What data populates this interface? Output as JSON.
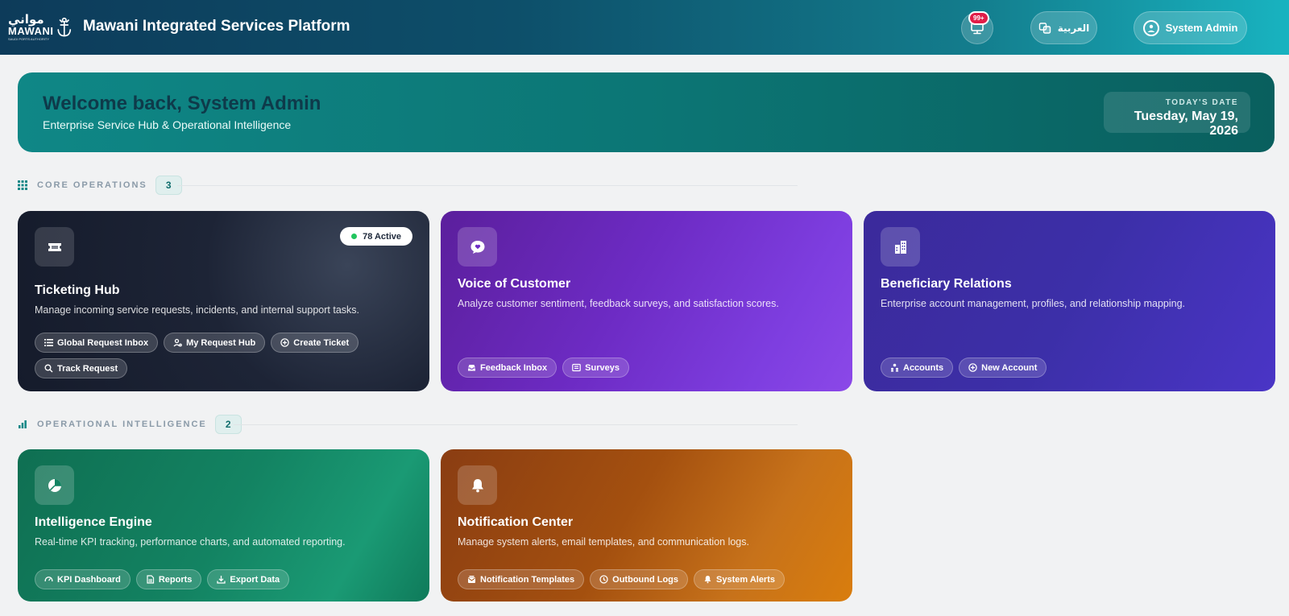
{
  "header": {
    "logo_ar": "مواني",
    "logo_en": "MAWANI",
    "logo_sub": "SAUDI PORTS AUTHORITY",
    "app_title": "Mawani Integrated Services Platform",
    "notifications_badge": "99+",
    "language_label": "العربية",
    "user_label": "System Admin"
  },
  "welcome": {
    "title": "Welcome back, System Admin",
    "subtitle": "Enterprise Service Hub & Operational Intelligence",
    "date_label": "TODAY'S DATE",
    "date_value": "Tuesday, May 19, 2026"
  },
  "sections": [
    {
      "title": "CORE OPERATIONS",
      "count": "3"
    },
    {
      "title": "OPERATIONAL INTELLIGENCE",
      "count": "2"
    }
  ],
  "cards": {
    "ticketing": {
      "title": "Ticketing Hub",
      "desc": "Manage incoming service requests, incidents, and internal support tasks.",
      "active_badge": "78 Active",
      "chips": [
        "Global Request Inbox",
        "My Request Hub",
        "Create Ticket",
        "Track Request"
      ]
    },
    "voc": {
      "title": "Voice of Customer",
      "desc": "Analyze customer sentiment, feedback surveys, and satisfaction scores.",
      "chips": [
        "Feedback Inbox",
        "Surveys"
      ]
    },
    "beneficiary": {
      "title": "Beneficiary Relations",
      "desc": "Enterprise account management, profiles, and relationship mapping.",
      "chips": [
        "Accounts",
        "New Account"
      ]
    },
    "intelligence": {
      "title": "Intelligence Engine",
      "desc": "Real-time KPI tracking, performance charts, and automated reporting.",
      "chips": [
        "KPI Dashboard",
        "Reports",
        "Export Data"
      ]
    },
    "notification": {
      "title": "Notification Center",
      "desc": "Manage system alerts, email templates, and communication logs.",
      "chips": [
        "Notification Templates",
        "Outbound Logs",
        "System Alerts"
      ]
    }
  },
  "colors": {
    "accent": "#0f8786",
    "header_start": "#0d3b5a",
    "header_end": "#18b3c0",
    "status_active": "#22c55e",
    "badge": "#e11d48"
  }
}
